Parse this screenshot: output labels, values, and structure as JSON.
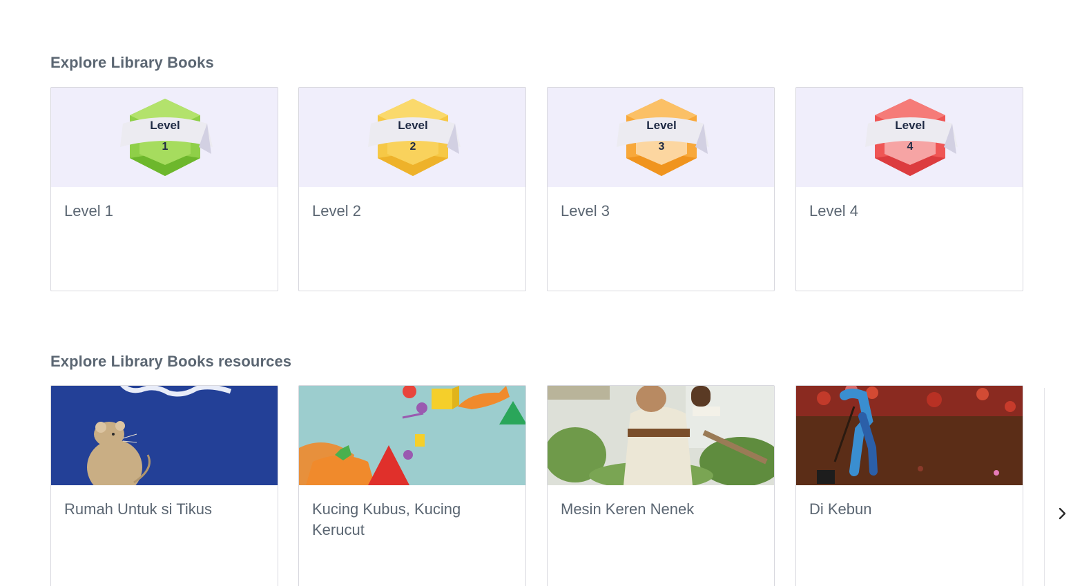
{
  "levels_section": {
    "title": "Explore Library Books",
    "cards": [
      {
        "label": "Level 1",
        "badge_word": "Level",
        "badge_number": "1",
        "badge_color": "#8fcf48"
      },
      {
        "label": "Level 2",
        "badge_word": "Level",
        "badge_number": "2",
        "badge_color": "#f6c846"
      },
      {
        "label": "Level 3",
        "badge_word": "Level",
        "badge_number": "3",
        "badge_color": "#f8a83a"
      },
      {
        "label": "Level 4",
        "badge_word": "Level",
        "badge_number": "4",
        "badge_color": "#ef5655"
      }
    ]
  },
  "resources_section": {
    "title": "Explore Library Books resources",
    "cards": [
      {
        "title": "Rumah Untuk si Tikus",
        "thumbnail": "mouse-cover-image"
      },
      {
        "title": "Kucing Kubus, Kucing Kerucut",
        "thumbnail": "cats-shapes-image"
      },
      {
        "title": "Mesin Keren Nenek",
        "thumbnail": "grandma-garden-image"
      },
      {
        "title": "Di Kebun",
        "thumbnail": "garden-digging-image"
      }
    ]
  },
  "carousel": {
    "next_icon": "chevron-right-icon"
  },
  "colors": {
    "heading": "#5b6672",
    "card_border": "#d8d8de",
    "card_top_bg": "#f0eefb"
  }
}
